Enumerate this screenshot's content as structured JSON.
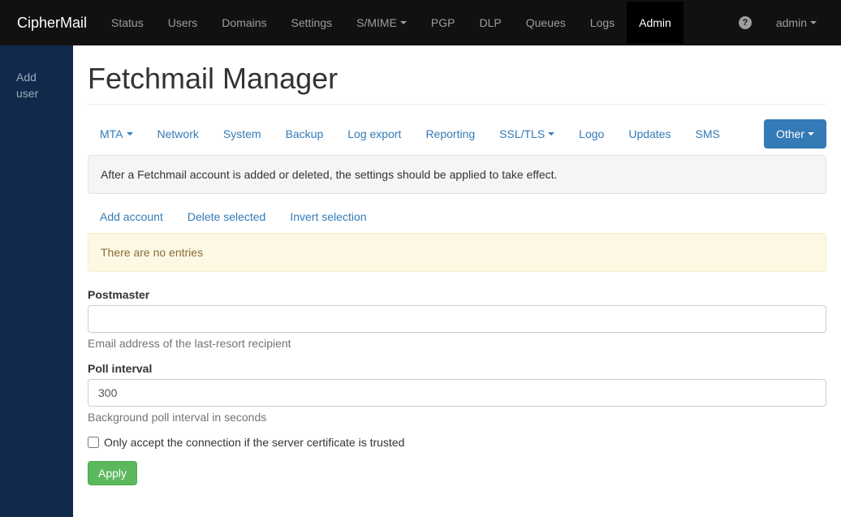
{
  "brand": "CipherMail",
  "topnav": {
    "items": [
      {
        "label": "Status"
      },
      {
        "label": "Users"
      },
      {
        "label": "Domains"
      },
      {
        "label": "Settings"
      },
      {
        "label": "S/MIME",
        "caret": true
      },
      {
        "label": "PGP"
      },
      {
        "label": "DLP"
      },
      {
        "label": "Queues"
      },
      {
        "label": "Logs"
      },
      {
        "label": "Admin",
        "active": true
      }
    ],
    "user_label": "admin"
  },
  "sidebar": {
    "items": [
      {
        "label": "Add user"
      }
    ]
  },
  "page": {
    "title": "Fetchmail Manager",
    "tabs": [
      {
        "label": "MTA",
        "caret": true
      },
      {
        "label": "Network"
      },
      {
        "label": "System"
      },
      {
        "label": "Backup"
      },
      {
        "label": "Log export"
      },
      {
        "label": "Reporting"
      },
      {
        "label": "SSL/TLS",
        "caret": true
      },
      {
        "label": "Logo"
      },
      {
        "label": "Updates"
      },
      {
        "label": "SMS"
      },
      {
        "label": "Other",
        "caret": true,
        "active": true
      }
    ],
    "info_well": "After a Fetchmail account is added or deleted, the settings should be applied to take effect.",
    "actions": [
      {
        "label": "Add account"
      },
      {
        "label": "Delete selected"
      },
      {
        "label": "Invert selection"
      }
    ],
    "no_entries": "There are no entries",
    "form": {
      "postmaster": {
        "label": "Postmaster",
        "value": "",
        "help": "Email address of the last-resort recipient"
      },
      "poll_interval": {
        "label": "Poll interval",
        "value": "300",
        "help": "Background poll interval in seconds"
      },
      "cert_trusted": {
        "label": "Only accept the connection if the server certificate is trusted",
        "checked": false
      },
      "apply_label": "Apply"
    }
  }
}
